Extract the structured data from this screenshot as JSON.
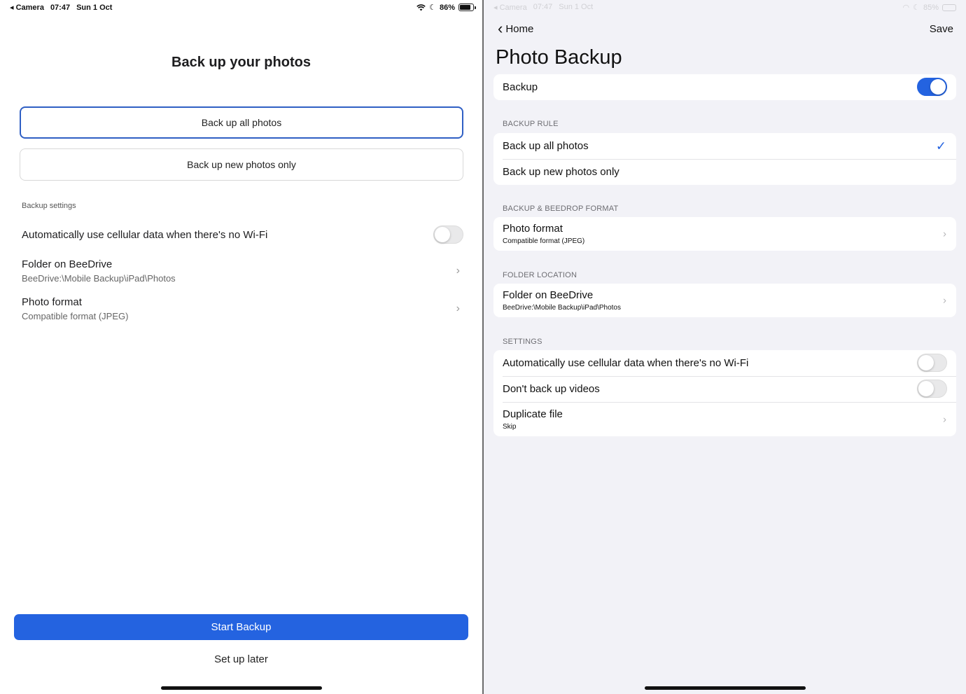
{
  "left": {
    "status": {
      "back_app": "Camera",
      "time": "07:47",
      "date": "Sun 1 Oct",
      "battery": "86%",
      "battery_fraction": 0.86
    },
    "title": "Back up your photos",
    "options": [
      "Back up all photos",
      "Back up new photos only"
    ],
    "section_label": "Backup settings",
    "rows": [
      {
        "main": "Automatically use cellular data when there's no Wi-Fi",
        "toggle_on": false
      },
      {
        "main": "Folder on BeeDrive",
        "sub": "BeeDrive:\\Mobile Backup\\iPad\\Photos"
      },
      {
        "main": "Photo format",
        "sub": "Compatible format (JPEG)"
      }
    ],
    "start_button": "Start Backup",
    "later_button": "Set up later"
  },
  "right": {
    "status": {
      "back_app": "Camera",
      "time": "07:47",
      "date": "Sun 1 Oct",
      "battery": "85%"
    },
    "nav": {
      "back": "Home",
      "save": "Save"
    },
    "title": "Photo Backup",
    "backup_row": {
      "label": "Backup",
      "toggle_on": true
    },
    "sections": {
      "rule": "BACKUP RULE",
      "format": "BACKUP & BEEDROP FORMAT",
      "folder": "FOLDER LOCATION",
      "settings": "SETTINGS"
    },
    "rule_rows": [
      "Back up all photos",
      "Back up new photos only"
    ],
    "format_row": {
      "main": "Photo format",
      "sub": "Compatible format (JPEG)"
    },
    "folder_row": {
      "main": "Folder on BeeDrive",
      "sub": "BeeDrive:\\Mobile Backup\\iPad\\Photos"
    },
    "settings_rows": [
      {
        "main": "Automatically use cellular data when there's no Wi-Fi",
        "toggle_on": false
      },
      {
        "main": "Don't back up videos",
        "toggle_on": false
      },
      {
        "main": "Duplicate file",
        "sub": "Skip"
      }
    ]
  },
  "colors": {
    "accent": "#2463e0",
    "selected_border": "#2f5fc4",
    "grouped_bg": "#f2f2f7"
  }
}
